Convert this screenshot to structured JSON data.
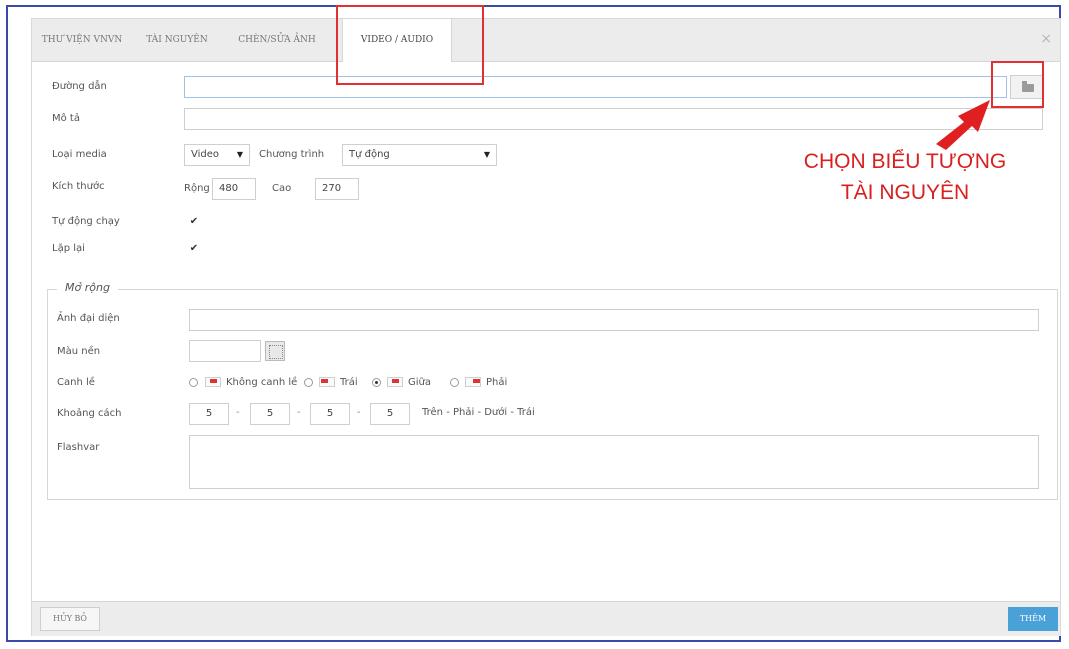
{
  "tabs": [
    {
      "label": "THƯ VIỆN VNVN"
    },
    {
      "label": "TÀI NGUYÊN"
    },
    {
      "label": "CHÈN/SỬA ẢNH"
    },
    {
      "label": "VIDEO / AUDIO"
    }
  ],
  "active_tab": "VIDEO / AUDIO",
  "close_icon": "×",
  "form": {
    "path_label": "Đường dẫn",
    "path_value": "",
    "desc_label": "Mô tả",
    "desc_value": "",
    "media_type_label": "Loại media",
    "media_type_value": "Video",
    "program_label": "Chương trình",
    "program_value": "Tự động",
    "size_label": "Kích thước",
    "width_label": "Rộng",
    "width_value": "480",
    "height_label": "Cao",
    "height_value": "270",
    "autoplay_label": "Tự động chạy",
    "autoplay_checked": true,
    "loop_label": "Lặp lại",
    "loop_checked": true
  },
  "advanced": {
    "legend": "Mở rộng",
    "thumbnail_label": "Ảnh đại diện",
    "bgcolor_label": "Màu nền",
    "align_label": "Canh lề",
    "align_options": [
      {
        "label": "Không canh lề",
        "selected": false
      },
      {
        "label": "Trái",
        "selected": false
      },
      {
        "label": "Giữa",
        "selected": true
      },
      {
        "label": "Phải",
        "selected": false
      }
    ],
    "spacing_label": "Khoảng cách",
    "spacing_values": [
      "5",
      "5",
      "5",
      "5"
    ],
    "spacing_hint": "Trên - Phải - Dưới - Trái",
    "flashvar_label": "Flashvar"
  },
  "footer": {
    "cancel_label": "HỦY BỎ",
    "ok_label": "THÊM"
  },
  "annotation": {
    "line1": "CHỌN BIỂU TƯỢNG",
    "line2": "TÀI NGUYÊN",
    "color": "#d92020"
  },
  "colors": {
    "accent_button": "#4aa1d8",
    "highlight": "#e03030",
    "frame": "#3b4aa8"
  }
}
